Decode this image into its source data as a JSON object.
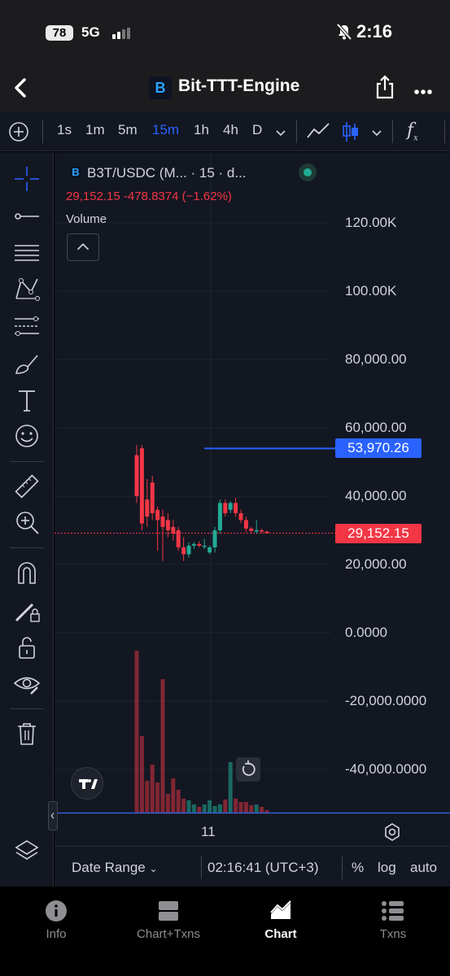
{
  "status": {
    "battery": "78",
    "network": "5G",
    "time": "2:16"
  },
  "header": {
    "title": "Bit-TTT-Engine",
    "logo_letter": "B"
  },
  "toolbar": {
    "intervals": [
      "1s",
      "1m",
      "5m",
      "15m",
      "1h",
      "4h",
      "D"
    ],
    "active_interval": "15m",
    "fx_label": "f"
  },
  "legend": {
    "symbol": "B3T/USDC (M...  · 15 · d...",
    "ohlc": "29,152.15  -478.8374 (−1.62%)",
    "volume_label": "Volume"
  },
  "chart_data": {
    "type": "candlestick",
    "y_axis_labels": [
      "120.00K",
      "100.00K",
      "80,000.00",
      "60,000.00",
      "40,000.00",
      "20,000.00",
      "0.0000",
      "-20,000.0000",
      "-40,000.0000"
    ],
    "y_axis_values": [
      120000,
      100000,
      80000,
      60000,
      40000,
      20000,
      0,
      -20000,
      -40000
    ],
    "ylim": [
      -53000,
      128000
    ],
    "price_lines": [
      {
        "label": "53,970.26",
        "value": 53970.26,
        "color": "#2962ff"
      },
      {
        "label": "29,152.15",
        "value": 29152.15,
        "color": "#f23645"
      }
    ],
    "x_labels": [
      "11"
    ],
    "candles": [
      {
        "o": 52000,
        "h": 55000,
        "l": 38000,
        "c": 40000
      },
      {
        "o": 54000,
        "h": 55000,
        "l": 30000,
        "c": 32000
      },
      {
        "o": 39000,
        "h": 45000,
        "l": 31000,
        "c": 34000
      },
      {
        "o": 44000,
        "h": 46000,
        "l": 33000,
        "c": 35000
      },
      {
        "o": 36000,
        "h": 37000,
        "l": 24000,
        "c": 33000
      },
      {
        "o": 34000,
        "h": 36000,
        "l": 21000,
        "c": 31000
      },
      {
        "o": 33000,
        "h": 35000,
        "l": 28000,
        "c": 30000
      },
      {
        "o": 31000,
        "h": 33000,
        "l": 27000,
        "c": 29000
      },
      {
        "o": 30000,
        "h": 31000,
        "l": 24000,
        "c": 25000
      },
      {
        "o": 25000,
        "h": 28000,
        "l": 21000,
        "c": 23000
      },
      {
        "o": 23000,
        "h": 26500,
        "l": 22000,
        "c": 25500
      },
      {
        "o": 25500,
        "h": 26500,
        "l": 24500,
        "c": 26000
      },
      {
        "o": 26000,
        "h": 26800,
        "l": 25000,
        "c": 25500
      },
      {
        "o": 25500,
        "h": 27500,
        "l": 24500,
        "c": 25500
      },
      {
        "o": 23500,
        "h": 25500,
        "l": 23000,
        "c": 25000
      },
      {
        "o": 25000,
        "h": 31000,
        "l": 23500,
        "c": 30000
      },
      {
        "o": 30000,
        "h": 39000,
        "l": 29000,
        "c": 38000
      },
      {
        "o": 38000,
        "h": 39000,
        "l": 34000,
        "c": 35000
      },
      {
        "o": 36000,
        "h": 38500,
        "l": 35000,
        "c": 38000
      },
      {
        "o": 38000,
        "h": 39500,
        "l": 34000,
        "c": 35000
      },
      {
        "o": 35000,
        "h": 36000,
        "l": 32000,
        "c": 33000
      },
      {
        "o": 33000,
        "h": 34000,
        "l": 29500,
        "c": 30500
      },
      {
        "o": 30500,
        "h": 31000,
        "l": 29000,
        "c": 29800
      },
      {
        "o": 29800,
        "h": 33000,
        "l": 29000,
        "c": 30000
      },
      {
        "o": 30000,
        "h": 30500,
        "l": 29200,
        "c": 29600
      },
      {
        "o": 29600,
        "h": 29900,
        "l": 29000,
        "c": 29152
      }
    ],
    "volume": [
      200,
      95,
      40,
      60,
      38,
      165,
      24,
      43,
      29,
      18,
      16,
      11,
      8,
      11,
      16,
      9,
      11,
      17,
      63,
      18,
      14,
      14,
      10,
      11,
      8,
      4
    ],
    "volume_max": 200
  },
  "time_row": {
    "time_label": "11"
  },
  "bottom_strip": {
    "date_range": "Date Range",
    "clock": "02:16:41 (UTC+3)",
    "percent": "%",
    "log": "log",
    "auto": "auto"
  },
  "nav": {
    "items": [
      {
        "label": "Info"
      },
      {
        "label": "Chart+Txns"
      },
      {
        "label": "Chart"
      },
      {
        "label": "Txns"
      }
    ],
    "active": "Chart"
  },
  "colors": {
    "up": "#22ab94",
    "down": "#f23645",
    "accent": "#2962ff",
    "bg": "#131722"
  }
}
